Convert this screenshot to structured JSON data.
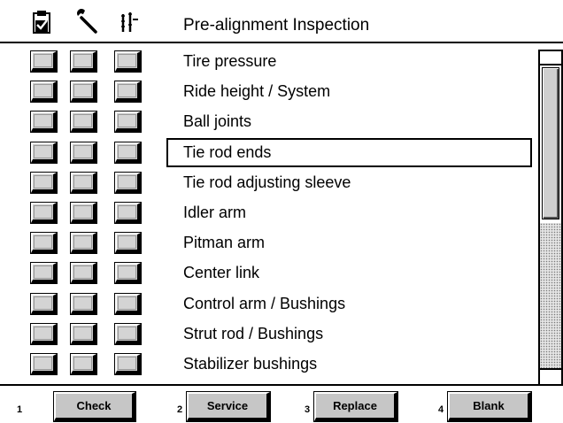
{
  "header": {
    "title": "Pre-alignment Inspection",
    "icons": [
      "clipboard-check-icon",
      "wrench-icon",
      "replace-part-icon"
    ]
  },
  "columns": [
    "Check",
    "Service",
    "Replace"
  ],
  "items": [
    {
      "label": "Tire pressure"
    },
    {
      "label": "Ride height / System"
    },
    {
      "label": "Ball joints"
    },
    {
      "label": "Tie rod ends",
      "selected": true
    },
    {
      "label": "Tie rod adjusting sleeve"
    },
    {
      "label": "Idler arm"
    },
    {
      "label": "Pitman arm"
    },
    {
      "label": "Center link"
    },
    {
      "label": "Control arm / Bushings"
    },
    {
      "label": "Strut rod / Bushings"
    },
    {
      "label": "Stabilizer bushings"
    }
  ],
  "function_keys": [
    {
      "number": "1",
      "label": "Check"
    },
    {
      "number": "2",
      "label": "Service"
    },
    {
      "number": "3",
      "label": "Replace"
    },
    {
      "number": "4",
      "label": "Blank"
    }
  ]
}
